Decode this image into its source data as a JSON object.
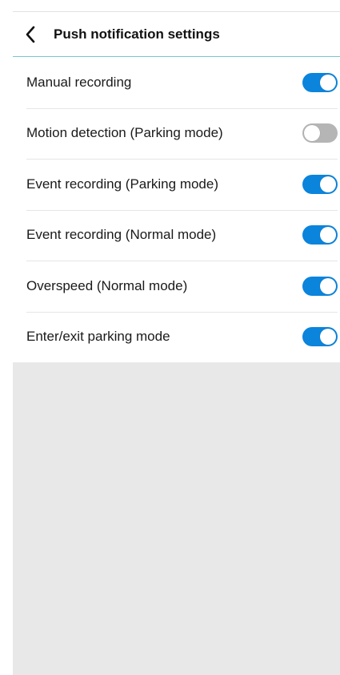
{
  "header": {
    "title": "Push notification settings",
    "back_icon": "chevron-left-icon"
  },
  "colors": {
    "toggle_on": "#0b84dc",
    "toggle_off": "#b5b5b5",
    "header_divider": "#7cc3d6",
    "background": "#e8e8e8"
  },
  "settings": [
    {
      "label": "Manual recording",
      "enabled": true
    },
    {
      "label": "Motion detection (Parking mode)",
      "enabled": false
    },
    {
      "label": "Event recording (Parking mode)",
      "enabled": true
    },
    {
      "label": "Event recording (Normal mode)",
      "enabled": true
    },
    {
      "label": "Overspeed (Normal mode)",
      "enabled": true
    },
    {
      "label": "Enter/exit parking mode",
      "enabled": true
    }
  ]
}
